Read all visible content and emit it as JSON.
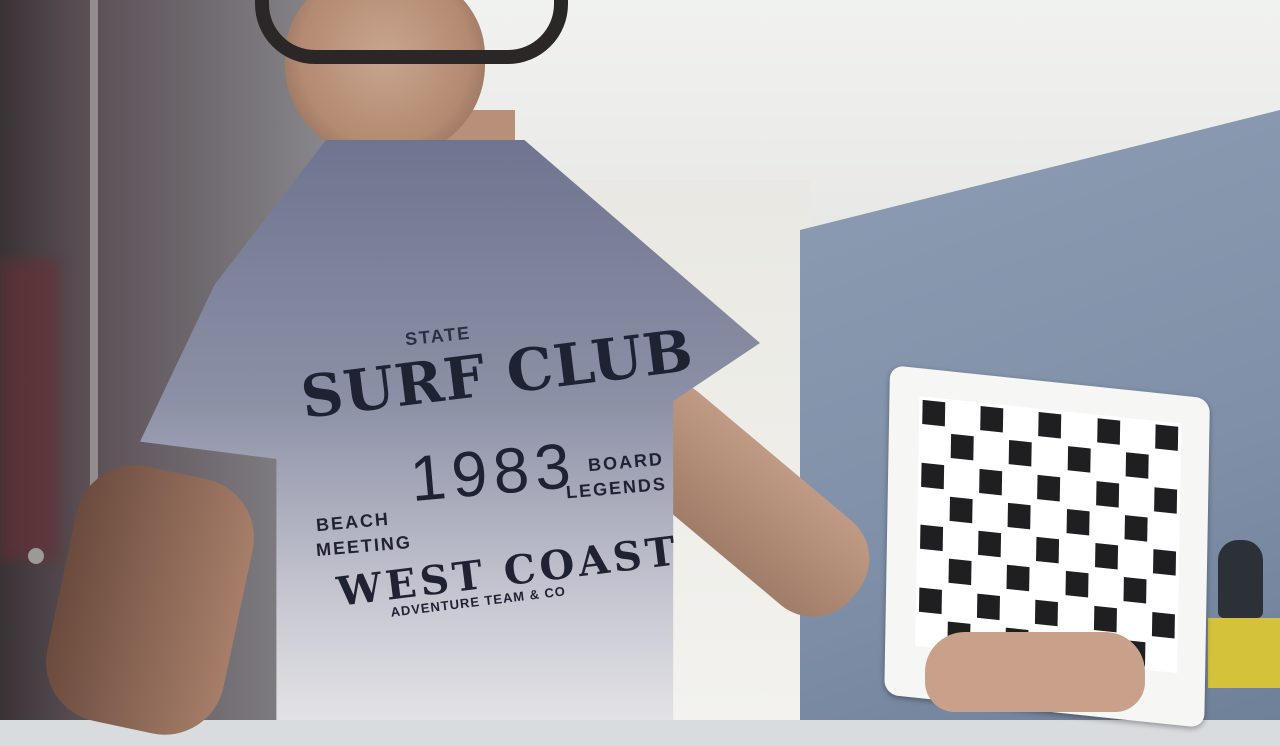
{
  "scene": {
    "description_colors": {
      "blue_wall": "#8193aa",
      "ceiling": "#eef0ee",
      "shirt": "#7a7f98",
      "print": "#1e2232"
    }
  },
  "shirt_print": {
    "line1": "STATE",
    "line2": "SURF CLUB",
    "year": "1983",
    "left_top": "BEACH",
    "left_bottom": "MEETING",
    "right_top": "BOARD",
    "right_bottom": "LEGENDS",
    "headline": "WEST COAST",
    "tagline": "ADVENTURE TEAM & CO"
  },
  "checkerboard": {
    "rows": 8,
    "cols": 9
  }
}
